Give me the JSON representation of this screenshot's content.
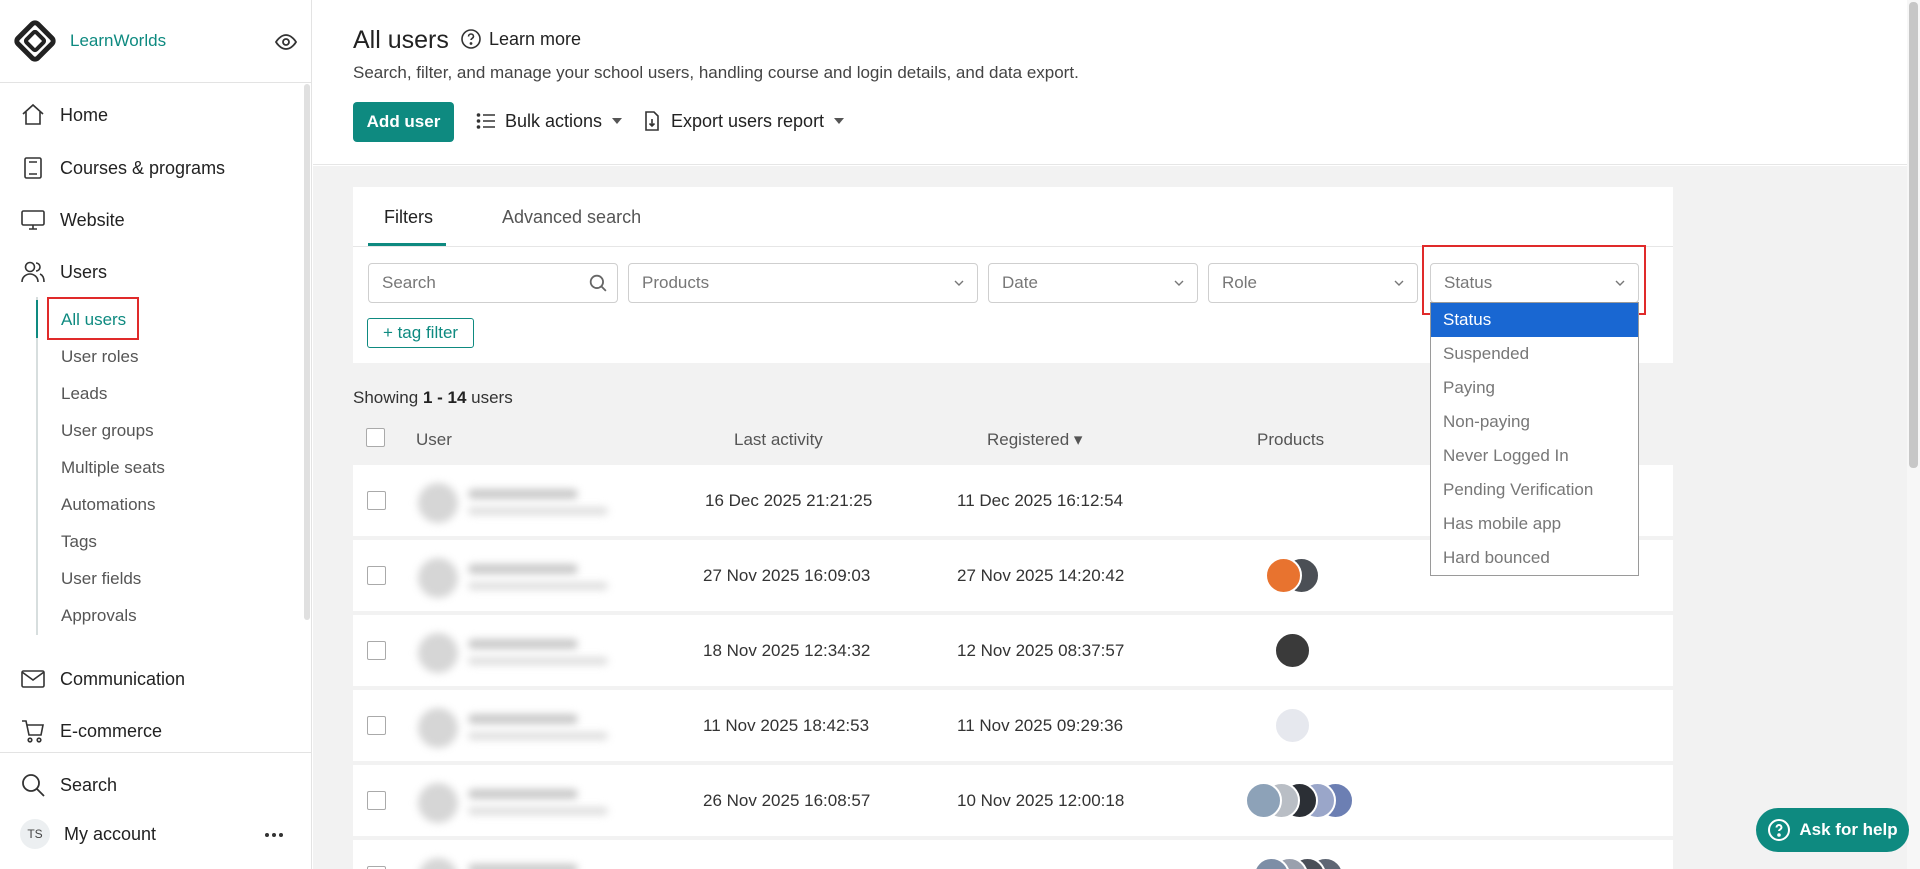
{
  "brand": {
    "name": "LearnWorlds"
  },
  "sidebar": {
    "nav": [
      {
        "label": "Home",
        "icon": "home-icon"
      },
      {
        "label": "Courses & programs",
        "icon": "book-icon"
      },
      {
        "label": "Website",
        "icon": "monitor-icon"
      },
      {
        "label": "Users",
        "icon": "users-icon"
      }
    ],
    "sub_items": [
      "All users",
      "User roles",
      "Leads",
      "User groups",
      "Multiple seats",
      "Automations",
      "Tags",
      "User fields",
      "Approvals"
    ],
    "bottom_nav": [
      {
        "label": "Communication",
        "icon": "mail-icon"
      },
      {
        "label": "E-commerce",
        "icon": "cart-icon"
      },
      {
        "label": "Search",
        "icon": "search-icon"
      }
    ],
    "account": {
      "initials": "TS",
      "label": "My account"
    }
  },
  "header": {
    "title": "All users",
    "learn_more": "Learn more",
    "subtitle": "Search, filter, and manage your school users, handling course and login details, and data export.",
    "add_user": "Add user",
    "bulk_actions": "Bulk actions",
    "export_report": "Export users report"
  },
  "filters": {
    "tabs": [
      "Filters",
      "Advanced search"
    ],
    "search_placeholder": "Search",
    "products": "Products",
    "date": "Date",
    "role": "Role",
    "status": "Status",
    "tag_filter": "+ tag filter",
    "status_options": [
      "Status",
      "Suspended",
      "Paying",
      "Non-paying",
      "Never Logged In",
      "Pending Verification",
      "Has mobile app",
      "Hard bounced"
    ]
  },
  "table": {
    "showing_prefix": "Showing ",
    "showing_range": "1 - 14",
    "showing_suffix": " users",
    "headers": {
      "user": "User",
      "last_activity": "Last activity",
      "registered": "Registered ▾",
      "products": "Products"
    },
    "rows": [
      {
        "last_activity": "16 Dec 2025 21:21:25",
        "registered": "11 Dec 2025 16:12:54",
        "products": []
      },
      {
        "last_activity": "27 Nov 2025 16:09:03",
        "registered": "27 Nov 2025 14:20:42",
        "products": [
          "#e8732f",
          "#4b4f55"
        ]
      },
      {
        "last_activity": "18 Nov 2025 12:34:32",
        "registered": "12 Nov 2025 08:37:57",
        "products": [
          "#3a3a3a"
        ]
      },
      {
        "last_activity": "11 Nov 2025 18:42:53",
        "registered": "11 Nov 2025 09:29:36",
        "products": [
          "#e6e8ee"
        ]
      },
      {
        "last_activity": "26 Nov 2025 16:08:57",
        "registered": "10 Nov 2025 12:00:18",
        "products": [
          "#8da2b8",
          "#b9bec5",
          "#2b2f35",
          "#9aa6c9",
          "#6c7fb3"
        ]
      },
      {
        "last_activity": "",
        "registered": "",
        "products": [
          "#7d8ea6",
          "#9aa0ad",
          "#4a4f58",
          "#5f6674"
        ]
      }
    ]
  },
  "help": {
    "label": "Ask for help"
  },
  "colors": {
    "accent": "#0e8a80",
    "highlight": "#e02a2a",
    "selected": "#1967d2"
  }
}
